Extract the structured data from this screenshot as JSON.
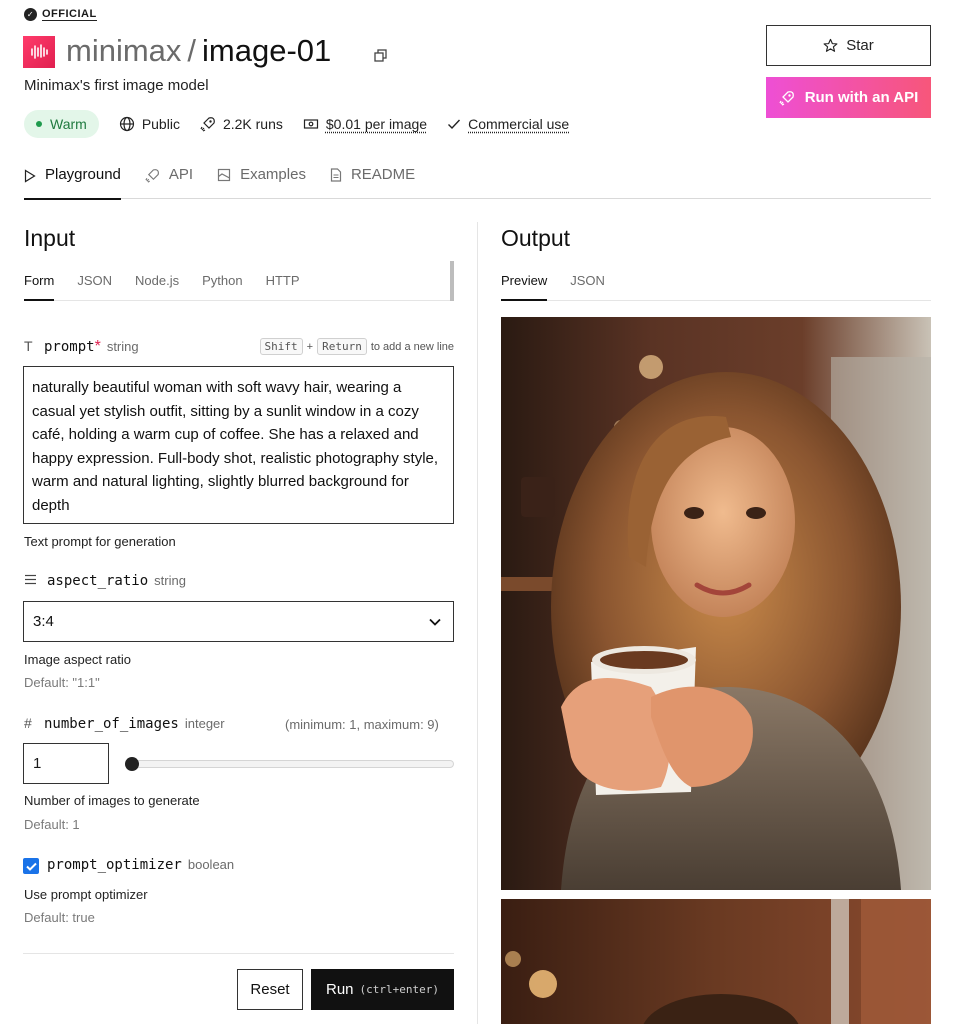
{
  "header": {
    "official_label": "OFFICIAL",
    "logo_text": "MINIMAX",
    "owner": "minimax",
    "separator": "/",
    "model": "image-01",
    "description": "Minimax's first image model",
    "status": "Warm",
    "visibility": "Public",
    "runs": "2.2K runs",
    "price": "$0.01 per image",
    "license": "Commercial use"
  },
  "actions": {
    "star_label": "Star",
    "api_label": "Run with an API"
  },
  "main_tabs": [
    {
      "label": "Playground",
      "active": true
    },
    {
      "label": "API",
      "active": false
    },
    {
      "label": "Examples",
      "active": false
    },
    {
      "label": "README",
      "active": false
    }
  ],
  "input": {
    "title": "Input",
    "tabs": [
      "Form",
      "JSON",
      "Node.js",
      "Python",
      "HTTP"
    ],
    "active_tab": "Form",
    "prompt": {
      "name": "prompt",
      "required_mark": "*",
      "type": "string",
      "shortcut_key1": "Shift",
      "shortcut_plus": "+",
      "shortcut_key2": "Return",
      "shortcut_hint": "to add a new line",
      "value": "naturally beautiful woman with soft wavy hair, wearing a casual yet stylish outfit, sitting by a sunlit window in a cozy café, holding a warm cup of coffee. She has a relaxed and happy expression. Full-body shot, realistic photography style, warm and natural lighting, slightly blurred background for depth",
      "help": "Text prompt for generation"
    },
    "aspect_ratio": {
      "name": "aspect_ratio",
      "type": "string",
      "value": "3:4",
      "help": "Image aspect ratio",
      "default": "Default: \"1:1\""
    },
    "number_of_images": {
      "name": "number_of_images",
      "type": "integer",
      "range": "(minimum: 1, maximum: 9)",
      "value": "1",
      "slider_fraction": 0,
      "help": "Number of images to generate",
      "default": "Default: 1"
    },
    "prompt_optimizer": {
      "name": "prompt_optimizer",
      "type": "boolean",
      "checked": true,
      "help": "Use prompt optimizer",
      "default": "Default: true"
    },
    "reset_label": "Reset",
    "run_label": "Run",
    "run_shortcut": "(ctrl+enter)"
  },
  "output": {
    "title": "Output",
    "tabs": [
      "Preview",
      "JSON"
    ],
    "active_tab": "Preview"
  },
  "colors": {
    "accent_pink": "#ee4fd5",
    "accent_coral": "#f7567a",
    "warm_green": "#1f7a3f",
    "checkbox_blue": "#1a73e8"
  }
}
